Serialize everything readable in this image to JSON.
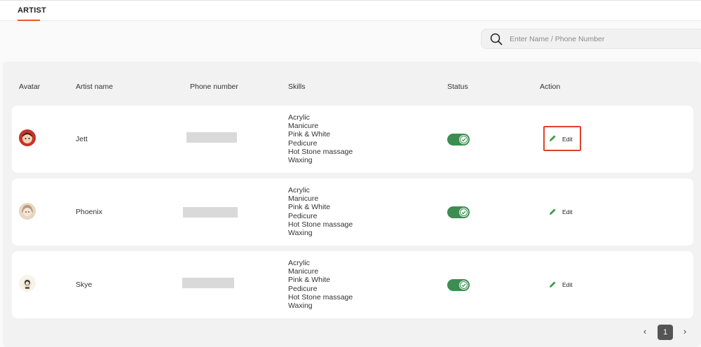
{
  "nav": {
    "tab_label": "ARTIST"
  },
  "search": {
    "placeholder": "Enter Name / Phone Number",
    "value": ""
  },
  "table": {
    "columns": {
      "avatar": "Avatar",
      "name": "Artist name",
      "phone": "Phone number",
      "skills": "Skills",
      "status": "Status",
      "action": "Action"
    },
    "rows": [
      {
        "name": "Jett",
        "skills": [
          "Acrylic",
          "Manicure",
          "Pink & White",
          "Pedicure",
          "Hot Stone massage",
          "Waxing"
        ],
        "status_on": true,
        "action_label": "Edit"
      },
      {
        "name": "Phoenix",
        "skills": [
          "Acrylic",
          "Manicure",
          "Pink & White",
          "Pedicure",
          "Hot Stone massage",
          "Waxing"
        ],
        "status_on": true,
        "action_label": "Edit"
      },
      {
        "name": "Skye",
        "skills": [
          "Acrylic",
          "Manicure",
          "Pink & White",
          "Pedicure",
          "Hot Stone massage",
          "Waxing"
        ],
        "status_on": true,
        "action_label": "Edit"
      }
    ]
  },
  "pagination": {
    "prev": "‹",
    "current_page": "1",
    "next": "›"
  },
  "colors": {
    "accent": "#e8582c",
    "toggle_on": "#3d8d52",
    "edit_icon": "#3d9a4a",
    "highlight": "#e0412d"
  }
}
